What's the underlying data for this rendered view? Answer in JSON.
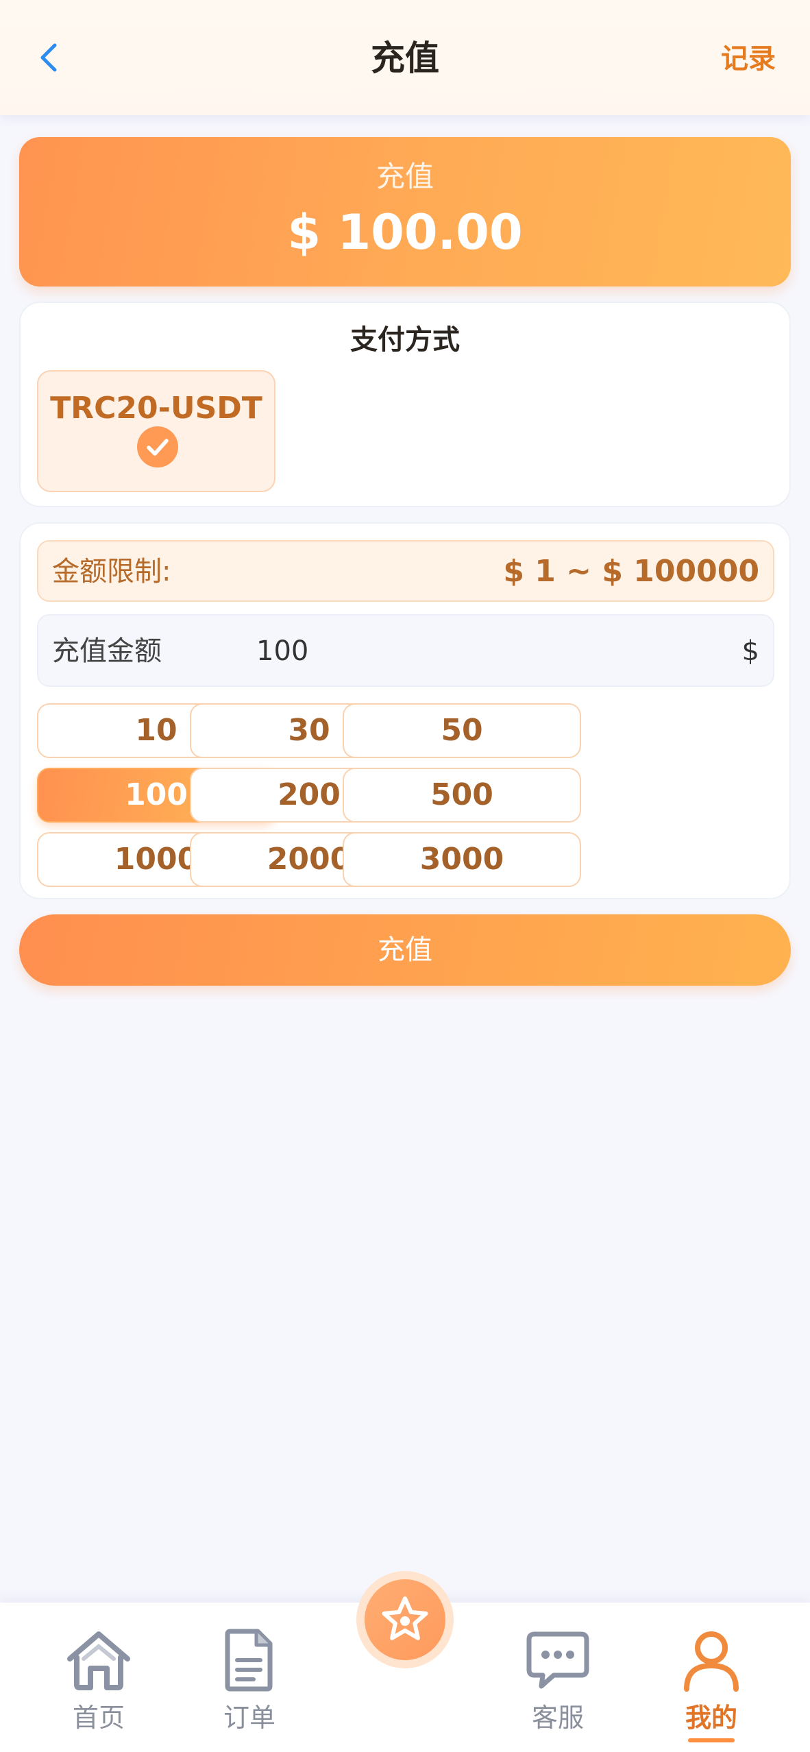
{
  "header": {
    "title": "充值",
    "record_label": "记录"
  },
  "summary": {
    "label": "充值",
    "amount": "$ 100.00"
  },
  "payment": {
    "title": "支付方式",
    "methods": [
      {
        "label": "TRC20-USDT",
        "selected": true
      }
    ]
  },
  "form": {
    "limit_label": "金额限制:",
    "limit_value": "$ 1 ~ $ 100000",
    "amount_label": "充值金额",
    "amount_value": "100",
    "currency": "$",
    "presets": [
      "10",
      "30",
      "50",
      "100",
      "200",
      "500",
      "1000",
      "2000",
      "3000"
    ],
    "selected_preset": "100"
  },
  "submit_label": "充值",
  "tabbar": {
    "items": [
      {
        "label": "首页",
        "icon": "home-icon"
      },
      {
        "label": "订单",
        "icon": "document-icon"
      },
      {
        "label": "",
        "icon": "star-icon"
      },
      {
        "label": "客服",
        "icon": "chat-icon"
      },
      {
        "label": "我的",
        "icon": "user-icon"
      }
    ],
    "active": "我的"
  },
  "colors": {
    "accent": "#ff9a50",
    "accent_text": "#e57a1f",
    "back_icon": "#2d8cf0"
  }
}
